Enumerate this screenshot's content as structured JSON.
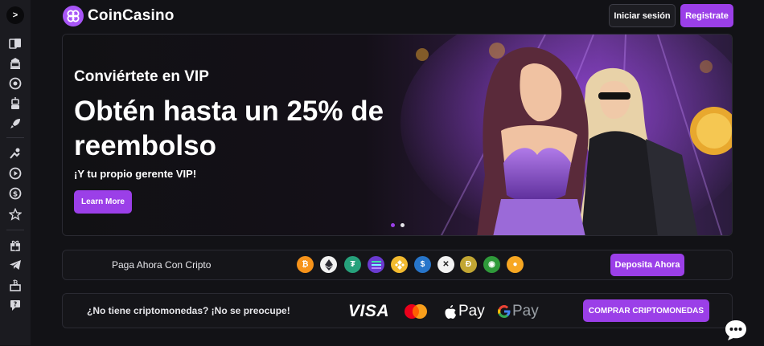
{
  "sidebar": {
    "toggle_glyph": ">",
    "icons": [
      "cards-icon",
      "casino-icon",
      "chip-icon",
      "robot-icon",
      "rocket-icon",
      "sports-icon",
      "play-icon",
      "dollar-coin-icon",
      "star-icon",
      "gift-icon",
      "telegram-icon",
      "bitcoin-wallet-icon",
      "support-icon"
    ]
  },
  "header": {
    "logo_text": "CoinCasino",
    "login_label": "Iniciar sesión",
    "register_label": "Registrate"
  },
  "hero": {
    "subtitle": "Conviértete en VIP",
    "title": "Obtén hasta un 25% de reembolso",
    "tagline": "¡Y tu propio gerente VIP!",
    "button_label": "Learn More",
    "slides": 2,
    "active_slide": 1
  },
  "crypto_bar": {
    "label": "Paga Ahora Con Cripto",
    "coins": [
      "bitcoin-icon",
      "ethereum-icon",
      "tether-icon",
      "solana-icon",
      "bnb-icon",
      "usdc-icon",
      "xrp-icon",
      "dogecoin-icon",
      "coin-icon",
      "bonk-icon"
    ],
    "button_label": "Deposita Ahora"
  },
  "fiat_bar": {
    "label": "¿No tiene criptomonedas? ¡No se preocupe!",
    "brands": {
      "visa": "VISA",
      "apple_pay": "Pay",
      "google_pay": "Pay"
    },
    "button_label": "COMPRAR CRIPTOMONEDAS"
  },
  "colors": {
    "accent": "#9b3fe8",
    "background": "#121216",
    "sidebar": "#1b1b20"
  }
}
